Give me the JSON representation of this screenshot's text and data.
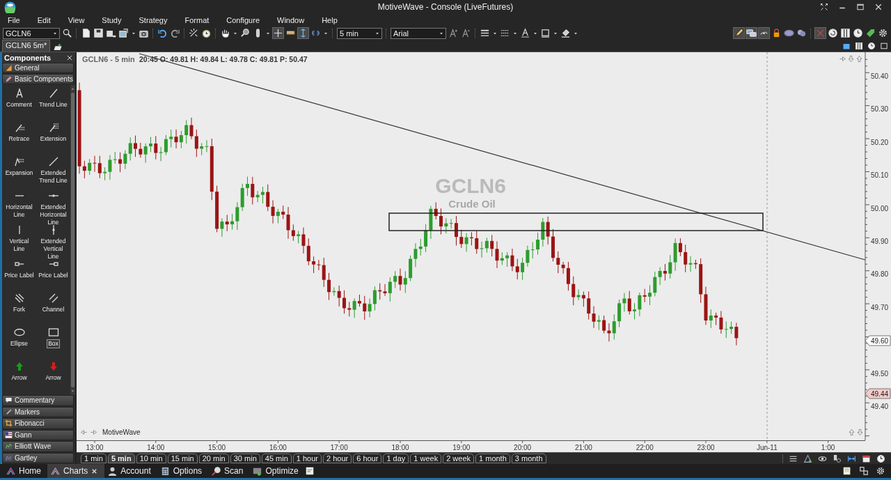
{
  "window": {
    "title": "MotiveWave - Console (LiveFutures)"
  },
  "menu": [
    "File",
    "Edit",
    "View",
    "Study",
    "Strategy",
    "Format",
    "Configure",
    "Window",
    "Help"
  ],
  "toolbar": {
    "symbol": "GCLN6",
    "interval": "5 min",
    "font": "Arial"
  },
  "document_tabs": [
    {
      "label": "GCLN6 5m*"
    }
  ],
  "components_panel": {
    "title": "Components",
    "sections_top": [
      {
        "label": "General"
      },
      {
        "label": "Basic Components"
      }
    ],
    "tools": [
      {
        "label": "Comment",
        "selected": false
      },
      {
        "label": "Trend Line",
        "selected": false
      },
      {
        "label": "Retrace",
        "selected": false
      },
      {
        "label": "Extension",
        "selected": false
      },
      {
        "label": "Expansion",
        "selected": false
      },
      {
        "label": "Extended Trend Line",
        "selected": false
      },
      {
        "label": "Horizontal Line",
        "selected": false
      },
      {
        "label": "Extended Horizontal Line",
        "selected": false
      },
      {
        "label": "Vertical Line",
        "selected": false
      },
      {
        "label": "Extended Vertical Line",
        "selected": false
      },
      {
        "label": "Price Label",
        "selected": false
      },
      {
        "label": "Price Label",
        "selected": false
      },
      {
        "label": "Fork",
        "selected": false
      },
      {
        "label": "Channel",
        "selected": false
      },
      {
        "label": "Ellipse",
        "selected": false
      },
      {
        "label": "Box",
        "selected": true
      },
      {
        "label": "Arrow",
        "selected": false
      },
      {
        "label": "Arrow",
        "selected": false
      }
    ],
    "sections_bottom": [
      {
        "label": "Commentary"
      },
      {
        "label": "Markers"
      },
      {
        "label": "Fibonacci"
      },
      {
        "label": "Gann"
      },
      {
        "label": "Elliott Wave"
      },
      {
        "label": "Gartley"
      }
    ]
  },
  "chart": {
    "title": "GCLN6 - 5 min",
    "bar_info": "20:45 O: 49.81 H: 49.84 L: 49.78 C: 49.81 P: 50.47",
    "watermark": {
      "symbol": "GCLN6",
      "name": "Crude Oil"
    },
    "price_ticks": [
      "50.40",
      "50.30",
      "50.20",
      "50.10",
      "50.00",
      "49.90",
      "49.80",
      "49.70",
      "49.50",
      "49.40"
    ],
    "time_ticks": [
      "13:00",
      "14:00",
      "15:00",
      "16:00",
      "17:00",
      "18:00",
      "19:00",
      "20:00",
      "21:00",
      "22:00",
      "23:00",
      "Jun-11",
      "1:00"
    ],
    "price_markers": [
      {
        "label": "49.60",
        "color": "#ffffff"
      },
      {
        "label": "49.44",
        "color": "#f6caca"
      }
    ],
    "footer": "MotiveWave"
  },
  "timeframes": [
    {
      "label": "1 min",
      "selected": false
    },
    {
      "label": "5 min",
      "selected": true
    },
    {
      "label": "10 min",
      "selected": false
    },
    {
      "label": "15 min",
      "selected": false
    },
    {
      "label": "20 min",
      "selected": false
    },
    {
      "label": "30 min",
      "selected": false
    },
    {
      "label": "45 min",
      "selected": false
    },
    {
      "label": "1 hour",
      "selected": false
    },
    {
      "label": "2 hour",
      "selected": false
    },
    {
      "label": "6 hour",
      "selected": false
    },
    {
      "label": "1 day",
      "selected": false
    },
    {
      "label": "1 week",
      "selected": false
    },
    {
      "label": "2 week",
      "selected": false
    },
    {
      "label": "1 month",
      "selected": false
    },
    {
      "label": "3 month",
      "selected": false
    }
  ],
  "taskbar": [
    {
      "label": "Home",
      "selected": false
    },
    {
      "label": "Charts",
      "selected": true
    },
    {
      "label": "Account",
      "selected": false
    },
    {
      "label": "Options",
      "selected": false
    },
    {
      "label": "Scan",
      "selected": false
    },
    {
      "label": "Optimize",
      "selected": false
    }
  ]
}
